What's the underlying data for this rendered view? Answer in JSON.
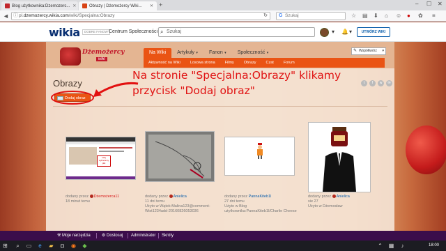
{
  "browser": {
    "tabs": [
      {
        "label": "Blog użytkownika:Dzemozerc...",
        "active": false,
        "favicon_color": "#c1272d"
      },
      {
        "label": "Obrazy | Dżemożercy Wiki...",
        "active": true,
        "favicon_color": "#d84315"
      }
    ],
    "url_prefix": "pl.",
    "url_domain": "dzemozercy.wikia.com",
    "url_path": "/wiki/Specjalna:Obrazy",
    "search_placeholder": "Szukaj"
  },
  "globalnav": {
    "logo": "wikia",
    "logo_sub": "DOBRE FANOW",
    "community_label": "Centrum Społeczności",
    "search_placeholder": "Szukaj",
    "create_wiki_label": "UTWÓRZ WIKI"
  },
  "wiki": {
    "logo_title": "Dżemożercy",
    "logo_sub": "wiki",
    "nav": [
      {
        "label": "Na Wiki",
        "active": true
      },
      {
        "label": "Artykuły",
        "active": false
      },
      {
        "label": "Fanon",
        "active": false
      },
      {
        "label": "Społeczność",
        "active": false
      }
    ],
    "subnav": [
      "Aktywność na Wiki",
      "Losowa strona",
      "Filmy",
      "Obrazy",
      "Czat",
      "Forum"
    ],
    "contribute_label": "Współtwórz"
  },
  "page": {
    "title": "Obrazy",
    "add_photo_label": "Dodaj obraz"
  },
  "annotation": {
    "line1": "Na stronie \"Specjalna:Obrazy\" klikamy",
    "line2": "przycisk \"Dodaj obraz\""
  },
  "gallery": [
    {
      "added_by": "dodany przez",
      "user": "Dżemożerca11",
      "time": "18 minut temu",
      "used_in": "",
      "used_link": ""
    },
    {
      "added_by": "dodany przez",
      "user": "Anielica",
      "time": "11 dni temu",
      "used_in": "Użyto w",
      "used_link": "Wątek:Malina123@comment-Wist1234add-20160826053036"
    },
    {
      "added_by": "dodany przez",
      "user": "PannaKiteb1l",
      "time": "27 dni temu",
      "used_in": "Użyto w",
      "used_link": "Blog użytkownika:PannaKiteb1l/Charlie Cheese"
    },
    {
      "added_by": "dodany przez",
      "user": "Anielica",
      "time": "sie 27",
      "used_in": "Użyto w",
      "used_link": "Dżemosław"
    }
  ],
  "thumb1_text": "tutaj wybieramy plik",
  "wikibar": {
    "tools": "Moje narzędzia",
    "customize": "Dostosuj",
    "admin": "Administrator",
    "shortcuts": "Skróty"
  },
  "taskbar": {
    "clock": "18:00"
  }
}
